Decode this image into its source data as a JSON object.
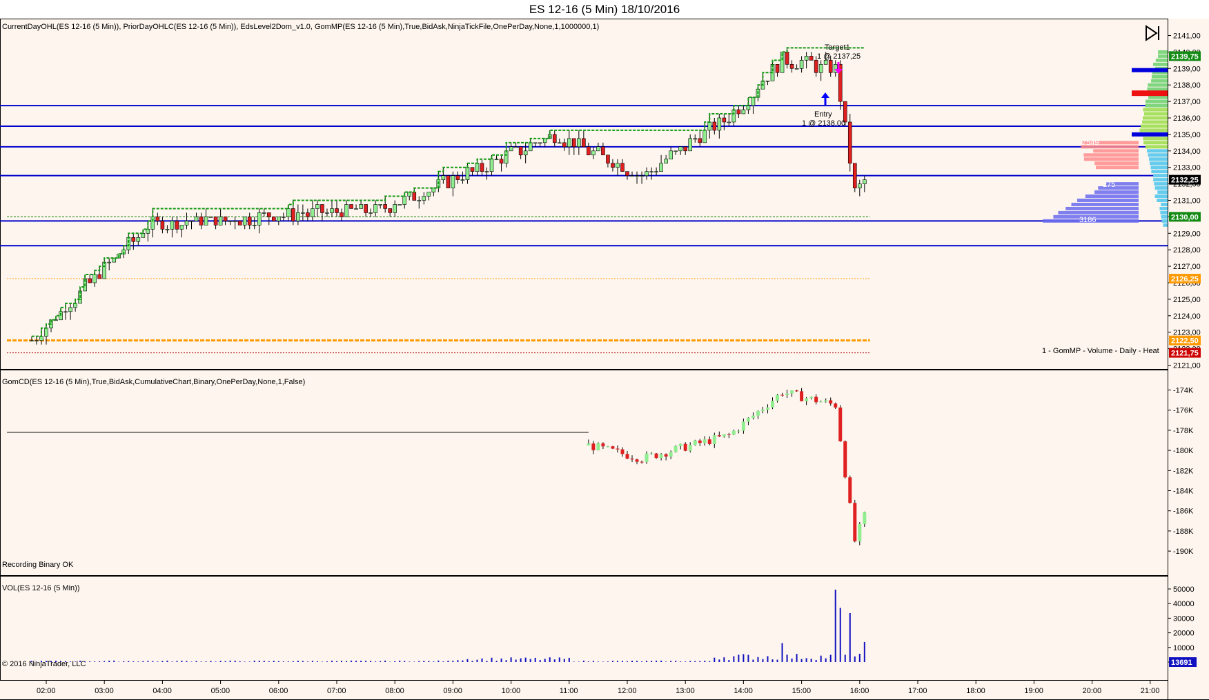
{
  "window": {
    "title": "ES 12-16 (5 Min)  18/10/2016"
  },
  "panels": {
    "price": {
      "indicator_label": "CurrentDayOHL(ES 12-16 (5 Min)), PriorDayOHLC(ES 12-16 (5 Min)), EdsLevel2Dom_v1.0, GomMP(ES 12-16 (5 Min),True,BidAsk,NinjaTickFile,OnePerDay,None,1,1000000,1)",
      "profile_label": "1 - GomMP - Volume - Daily - Heat",
      "annotations": {
        "target_name": "Target1",
        "target_fill": "1 @ 2137,25",
        "entry_name": "Entry",
        "entry_fill": "1 @ 2138,00"
      },
      "profile_numbers": {
        "top": "7549",
        "mid": "275",
        "bottom": "3186"
      }
    },
    "delta": {
      "indicator_label": "GomCD(ES 12-16 (5 Min),True,BidAsk,CumulativeChart,Binary,OnePerDay,None,1,False)",
      "status": "Recording Binary OK"
    },
    "volume": {
      "indicator_label": "VOL(ES 12-16 (5 Min))",
      "copyright": "© 2016 NinjaTrader, LLC"
    }
  },
  "colors": {
    "background": "#fdf5ee",
    "up_candle": "#90ee90",
    "down_candle": "#e02020",
    "level_line": "#0000cc",
    "prior_high_line": "#008000",
    "prior_low_line": "#ff9900",
    "volume_bar": "#1010c0",
    "last_price_tag": "#000000",
    "high_tag": "#138a13",
    "pivot_tag": "#ff9900",
    "low_tag": "#cc0000"
  },
  "chart_data": [
    {
      "type": "candlestick",
      "series": [
        {
          "name": "ES 12-16 (5 Min)"
        }
      ],
      "x_axis": {
        "ticks": [
          "02:00",
          "03:00",
          "04:00",
          "05:00",
          "06:00",
          "07:00",
          "08:00",
          "09:00",
          "10:00",
          "11:00",
          "12:00",
          "13:00",
          "14:00",
          "15:00",
          "16:00",
          "17:00",
          "18:00",
          "19:00",
          "20:00",
          "21:00"
        ]
      },
      "y_axis": {
        "range": [
          2120.5,
          2141.5
        ],
        "ticks": [
          "2121,00",
          "2122,00",
          "2123,00",
          "2124,00",
          "2125,00",
          "2126,00",
          "2127,00",
          "2128,00",
          "2129,00",
          "2130,00",
          "2131,00",
          "2132,00",
          "2133,00",
          "2134,00",
          "2135,00",
          "2136,00",
          "2137,00",
          "2138,00",
          "2139,00",
          "2140,00",
          "2141,00"
        ]
      },
      "price_tags": [
        {
          "label": "2139,75",
          "value": 2139.75,
          "color": "#138a13"
        },
        {
          "label": "2132,25",
          "value": 2132.25,
          "color": "#000000"
        },
        {
          "label": "2130,00",
          "value": 2130.0,
          "color": "#138a13"
        },
        {
          "label": "2126,25",
          "value": 2126.25,
          "color": "#ff9900"
        },
        {
          "label": "2122,50",
          "value": 2122.5,
          "color": "#ff9900"
        },
        {
          "label": "2121,75",
          "value": 2121.75,
          "color": "#cc0000"
        }
      ],
      "horizontal_levels": [
        2136.75,
        2135.5,
        2134.25,
        2132.5,
        2129.75,
        2128.25
      ],
      "key_points": [
        {
          "time": "01:45",
          "price": 2122.5
        },
        {
          "time": "03:45",
          "price": 2129.5
        },
        {
          "time": "07:45",
          "price": 2130.5
        },
        {
          "time": "09:30",
          "price": 2133.0
        },
        {
          "time": "10:45",
          "price": 2135.0
        },
        {
          "time": "12:15",
          "price": 2132.5
        },
        {
          "time": "13:45",
          "price": 2136.0
        },
        {
          "time": "14:40",
          "price": 2139.5
        },
        {
          "time": "15:35",
          "price": 2139.0
        },
        {
          "time": "15:55",
          "price": 2131.5
        },
        {
          "time": "16:05",
          "price": 2132.25
        }
      ]
    },
    {
      "type": "bar",
      "name": "GomCD cumulative delta",
      "y_axis": {
        "ticks": [
          "-174K",
          "-176K",
          "-178K",
          "-180K",
          "-182K",
          "-184K",
          "-186K",
          "-188K",
          "-190K"
        ],
        "range": [
          -190500,
          -173500
        ]
      },
      "flat_line_value": -178200,
      "key_points": [
        {
          "time": "11:20",
          "value": -179500
        },
        {
          "time": "12:15",
          "value": -180800
        },
        {
          "time": "13:45",
          "value": -178500
        },
        {
          "time": "14:40",
          "value": -174200
        },
        {
          "time": "15:35",
          "value": -175500
        },
        {
          "time": "15:55",
          "value": -189000
        },
        {
          "time": "16:05",
          "value": -186500
        }
      ]
    },
    {
      "type": "bar",
      "name": "VOL",
      "y_axis": {
        "ticks": [
          "50000",
          "40000",
          "30000",
          "20000",
          "10000",
          "0"
        ],
        "range": [
          0,
          53000
        ]
      },
      "last_value_label": "13691",
      "last_value": 13691,
      "peak_values": [
        {
          "time": "14:40",
          "value": 13000
        },
        {
          "time": "15:35",
          "value": 49500
        },
        {
          "time": "15:40",
          "value": 37000
        },
        {
          "time": "15:50",
          "value": 33500
        },
        {
          "time": "16:05",
          "value": 13691
        }
      ]
    }
  ]
}
